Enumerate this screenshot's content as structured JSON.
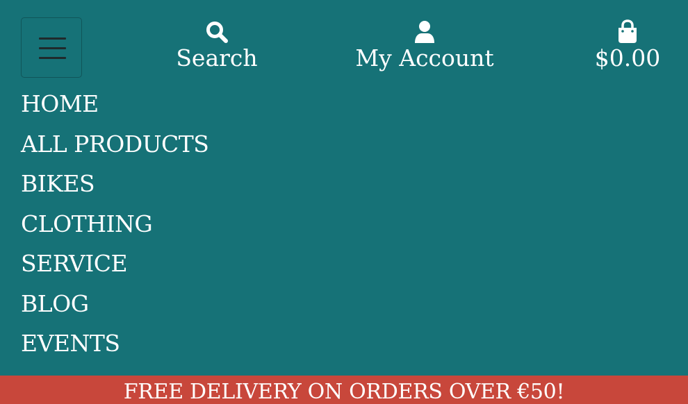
{
  "header": {
    "menu_toggle_icon": "hamburger-icon",
    "search": {
      "icon": "search-icon",
      "label": "Search"
    },
    "account": {
      "icon": "user-icon",
      "label": "My Account"
    },
    "cart": {
      "icon": "shopping-bag-icon",
      "label": "$0.00"
    }
  },
  "nav": {
    "items": [
      {
        "label": "HOME"
      },
      {
        "label": "ALL PRODUCTS"
      },
      {
        "label": "BIKES"
      },
      {
        "label": "CLOTHING"
      },
      {
        "label": "SERVICE"
      },
      {
        "label": "BLOG"
      },
      {
        "label": "EVENTS"
      }
    ]
  },
  "banner": {
    "text": "FREE DELIVERY ON ORDERS OVER €50!"
  },
  "colors": {
    "background": "#167277",
    "banner": "#c8473b",
    "text": "#ffffff"
  }
}
